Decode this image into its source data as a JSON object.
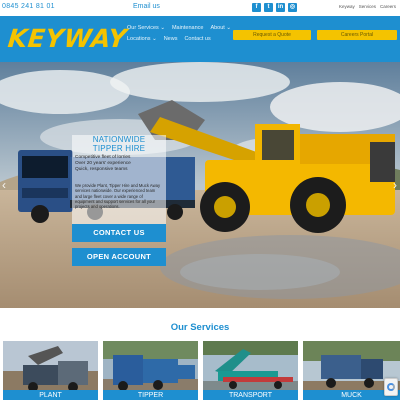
{
  "topbar": {
    "phone": "0845 241 81 01",
    "email": "Email us",
    "socials": [
      {
        "icon": "facebook-icon",
        "glyph": "f"
      },
      {
        "icon": "twitter-icon",
        "glyph": "t"
      },
      {
        "icon": "linkedin-icon",
        "glyph": "in"
      },
      {
        "icon": "instagram-icon",
        "glyph": "◎"
      }
    ],
    "links": [
      "Keyway",
      "Services",
      "Careers"
    ]
  },
  "header": {
    "logo": "KEYWAY",
    "nav": [
      "Our Services ⌄",
      "Maintenance",
      "About ⌄",
      "Locations ⌄",
      "News",
      "Contact us"
    ],
    "buttons": [
      "Request a Quote",
      "Careers Portal"
    ]
  },
  "hero": {
    "title_line1": "NATIONWIDE",
    "title_line2": "TIPPER HIRE",
    "bullets": [
      "Competitive fleet of lorries",
      "Over 20 years' experience",
      "Quick, responsive teams"
    ],
    "paragraph": "We provide Plant, Tipper Hire and Muck Away services nationwide. Our experienced team and large fleet cover a wide range of equipment and support services for all your projects and operations.",
    "contact_button": "CONTACT US",
    "account_button": "OPEN ACCOUNT"
  },
  "services": {
    "title": "Our Services",
    "cards": [
      "PLANT",
      "TIPPER",
      "TRANSPORT",
      "MUCK"
    ]
  },
  "colors": {
    "brand_blue": "#1e8fd0",
    "brand_yellow": "#f4c300"
  }
}
